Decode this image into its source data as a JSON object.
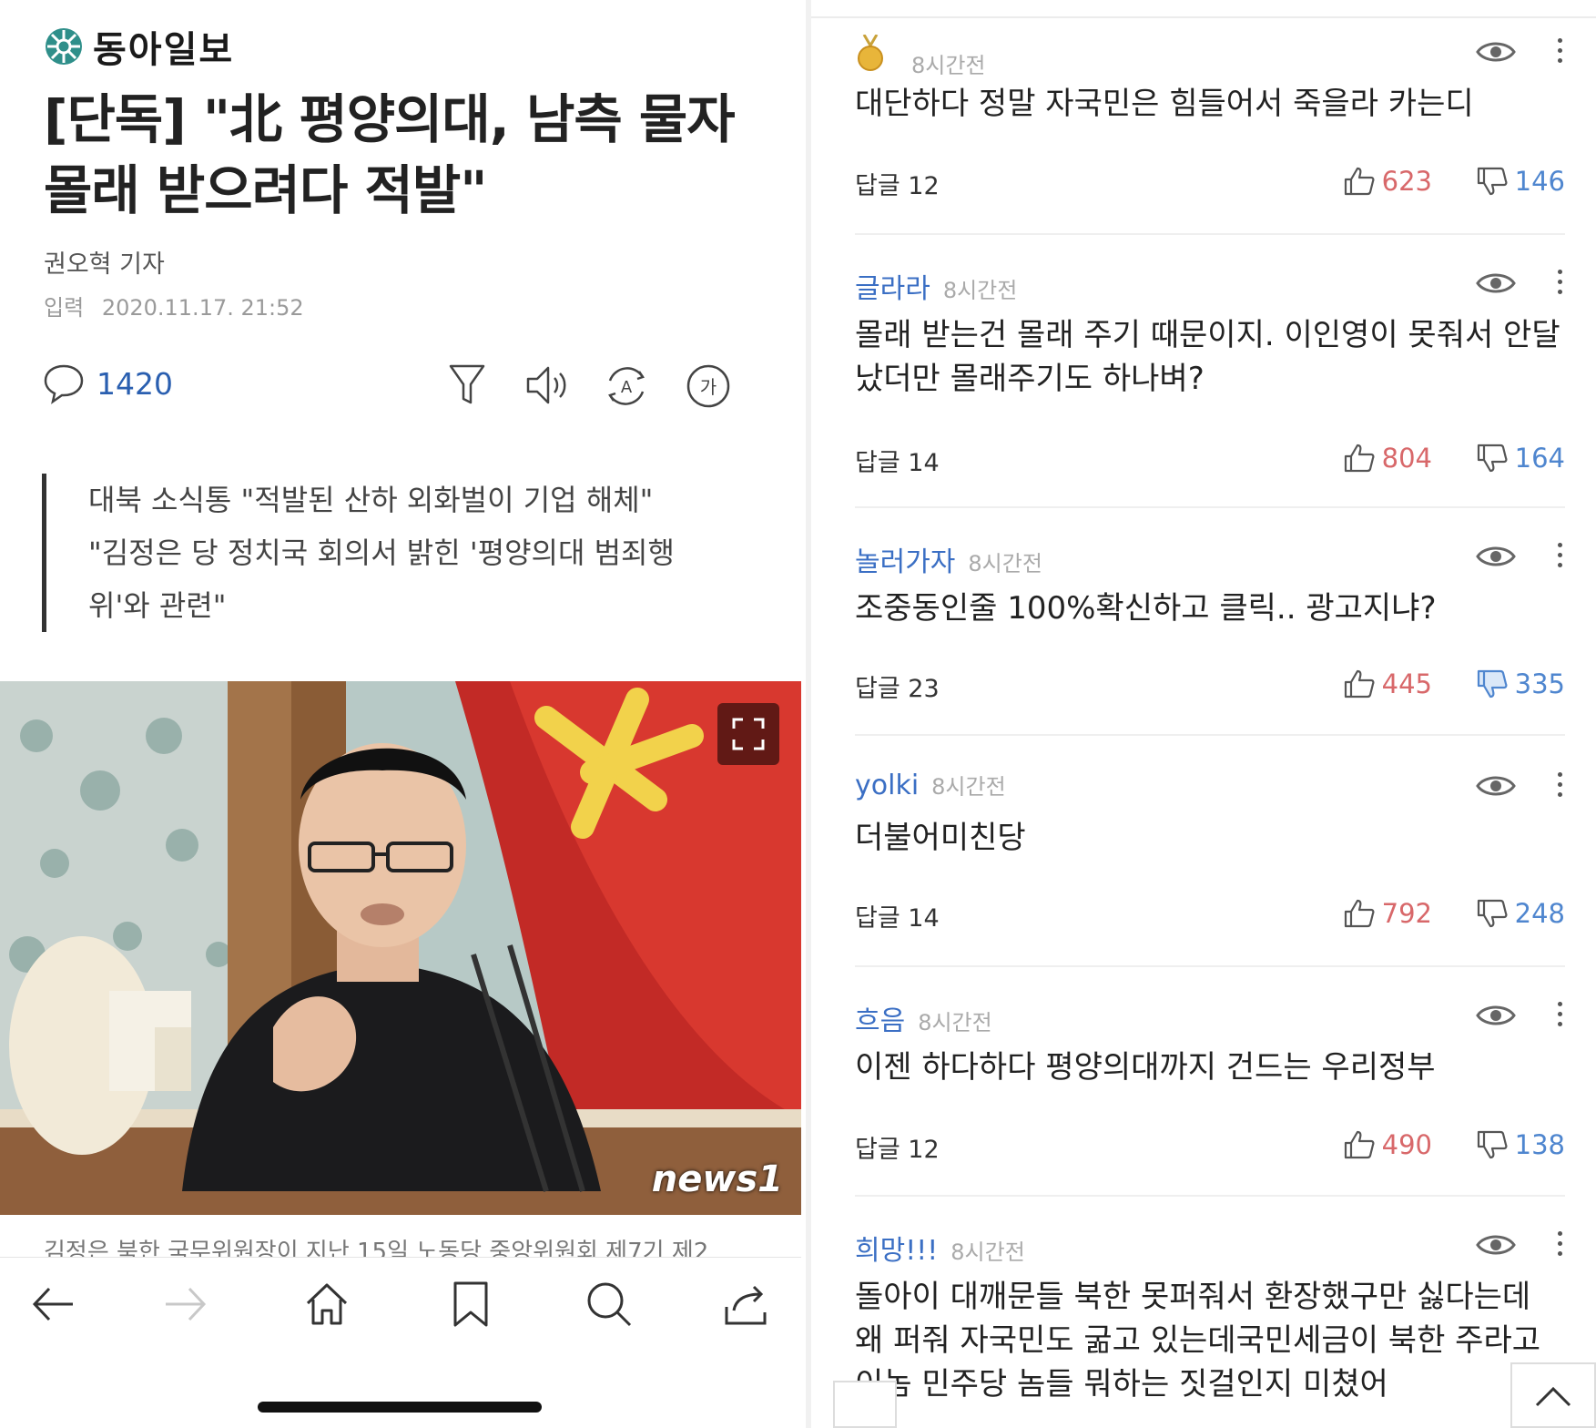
{
  "article": {
    "publisher": "동아일보",
    "headline": "[단독] \"北 평양의대, 남측 물자 몰래 받으려다 적발\"",
    "reporter": "권오혁 기자",
    "date_label": "입력",
    "date_value": "2020.11.17. 21:52",
    "comment_count": "1420",
    "summary": [
      "대북 소식통 \"적발된 산하 외화벌이 기업 해체\"",
      "\"김정은 당 정치국 회의서 밝힌 '평양의대 범죄행위'와 관련\""
    ],
    "photo_watermark": "news1",
    "caption": "김정은 북한 국무위원장이 지난 15일 노동당 중앙위원회 제7기 제2"
  },
  "icons": {
    "logo": "dong-a-logo-icon",
    "comment": "speech-bubble-icon",
    "filter": "filter-icon",
    "audio": "speaker-icon",
    "translate": "translate-icon",
    "font": "font-size-icon",
    "expand": "fullscreen-icon",
    "back": "arrow-left-icon",
    "forward": "arrow-right-icon",
    "home": "home-icon",
    "bookmark": "bookmark-icon",
    "search": "search-icon",
    "share": "share-icon",
    "eye": "eye-icon",
    "like": "thumbs-up-icon",
    "dislike": "thumbs-down-icon"
  },
  "colors": {
    "accent_blue": "#2a5fb0",
    "username_blue": "#3b6fc4",
    "like_red": "#d8686a",
    "dislike_blue": "#4f86cf"
  },
  "comments": [
    {
      "user": "",
      "time": "8시간전",
      "text": "대단하다 정말 자국민은 힘들어서 죽을라 카는디",
      "replies": "답글 12",
      "likes": "623",
      "dislikes": "146"
    },
    {
      "user": "글라라",
      "time": "8시간전",
      "text": "몰래 받는건 몰래 주기 때문이지. 이인영이 못줘서 안달 났더만 몰래주기도 하나벼?",
      "replies": "답글 14",
      "likes": "804",
      "dislikes": "164"
    },
    {
      "user": "놀러가자",
      "time": "8시간전",
      "text": "조중동인줄 100%확신하고 클릭.. 광고지냐?",
      "replies": "답글 23",
      "likes": "445",
      "dislikes": "335"
    },
    {
      "user": "yolki",
      "time": "8시간전",
      "text": "더불어미친당",
      "replies": "답글 14",
      "likes": "792",
      "dislikes": "248"
    },
    {
      "user": "흐음",
      "time": "8시간전",
      "text": "이젠 하다하다 평양의대까지 건드는 우리정부",
      "replies": "답글 12",
      "likes": "490",
      "dislikes": "138"
    },
    {
      "user": "희망!!!",
      "time": "8시간전",
      "text": "돌아이 대깨문들 북한 못퍼줘서 환장했구만 싫다는데 왜 퍼줘 자국민도 굶고 있는데국민세금이 북한 주라고 이놈 민주당 놈들 뭐하는 짓걸인지 미쳤어",
      "replies": "",
      "likes": "",
      "dislikes": ""
    }
  ]
}
